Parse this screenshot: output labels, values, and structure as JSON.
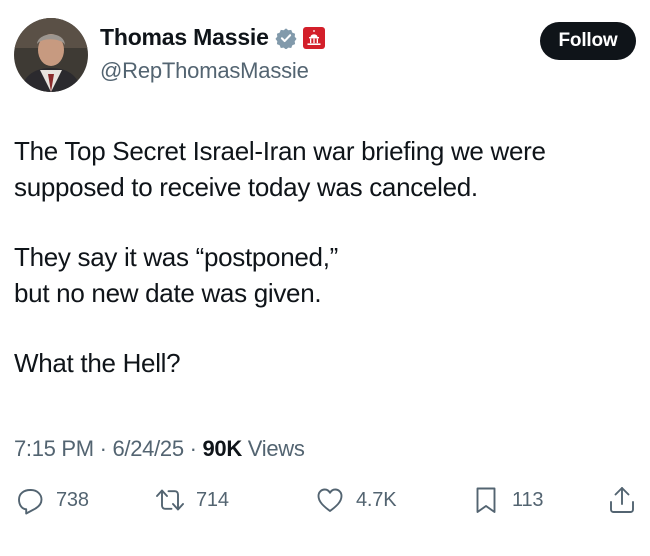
{
  "author": {
    "display_name": "Thomas Massie",
    "handle": "@RepThomasMassie",
    "verified_icon": "verified-badge-icon",
    "affiliation_icon": "capitol-building-icon",
    "follow_label": "Follow"
  },
  "tweet": {
    "paragraphs": [
      [
        "The Top Secret Israel-Iran war briefing we were",
        "supposed to receive today was canceled."
      ],
      [
        "They say it was “postponed,”",
        "but no new date was given."
      ],
      [
        "What the Hell?"
      ]
    ]
  },
  "meta": {
    "time": "7:15 PM",
    "date": "6/24/25",
    "views_count": "90K",
    "views_label": "Views",
    "separator": "·"
  },
  "actions": {
    "replies": "738",
    "reposts": "714",
    "likes": "4.7K",
    "bookmarks": "113"
  },
  "colors": {
    "text": "#0f1419",
    "secondary": "#536471",
    "verified_badge": "#829aab",
    "gov_badge": "#d31f2a"
  }
}
